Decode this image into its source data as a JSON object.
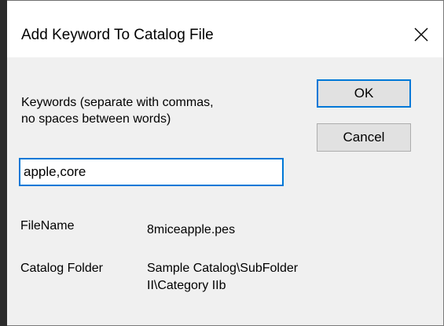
{
  "dialog": {
    "title": "Add Keyword To Catalog File",
    "close_icon": "close-icon"
  },
  "keywords": {
    "instruction_line1": "Keywords (separate with commas,",
    "instruction_line2": "no spaces between words)",
    "value": "apple,core"
  },
  "buttons": {
    "ok_label": "OK",
    "cancel_label": "Cancel"
  },
  "file_info": {
    "filename_label": "FileName",
    "filename_value": "8miceapple.pes",
    "folder_label": "Catalog Folder",
    "folder_value_line1": "Sample Catalog\\SubFolder",
    "folder_value_line2": "II\\Category IIb"
  }
}
